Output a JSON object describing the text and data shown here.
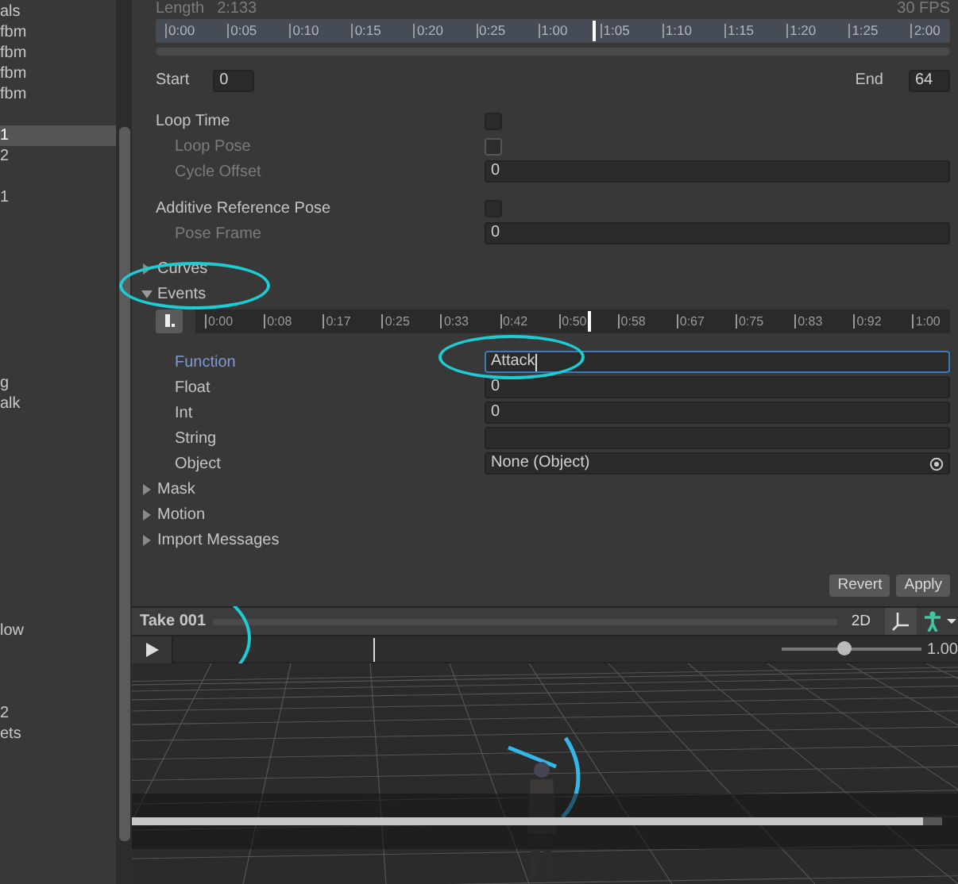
{
  "sidebar": {
    "items": [
      {
        "text": "als",
        "selected": false
      },
      {
        "text": "fbm",
        "selected": false
      },
      {
        "text": "fbm",
        "selected": false
      },
      {
        "text": "fbm",
        "selected": false
      },
      {
        "text": "fbm",
        "selected": false
      },
      {
        "text": "1",
        "selected": true
      },
      {
        "text": "2",
        "selected": false
      },
      {
        "text": "1",
        "selected": false
      },
      {
        "text": "g",
        "selected": false
      },
      {
        "text": "alk",
        "selected": false
      },
      {
        "text": "low",
        "selected": false
      },
      {
        "text": "2",
        "selected": false
      },
      {
        "text": "ets",
        "selected": false
      }
    ]
  },
  "clip": {
    "length_label": "Length",
    "length": "2:133",
    "fps": "30 FPS",
    "ruler": [
      "0:00",
      "0:05",
      "0:10",
      "0:15",
      "0:20",
      "0:25",
      "1:00",
      "1:05",
      "1:10",
      "1:15",
      "1:20",
      "1:25",
      "2:00"
    ],
    "start_label": "Start",
    "start": "0",
    "end_label": "End",
    "end": "64"
  },
  "properties": [
    {
      "kind": "checkbox",
      "label": "Loop Time",
      "indented": false,
      "disabled": false,
      "checked": false
    },
    {
      "kind": "checkbox",
      "label": "Loop Pose",
      "indented": true,
      "disabled": true,
      "checked": false
    },
    {
      "kind": "field",
      "label": "Cycle Offset",
      "indented": true,
      "disabled": true,
      "value": "0"
    },
    {
      "kind": "checkbox",
      "label": "Additive Reference Pose",
      "indented": false,
      "disabled": false,
      "checked": false
    },
    {
      "kind": "field",
      "label": "Pose Frame",
      "indented": true,
      "disabled": true,
      "value": "0"
    }
  ],
  "foldouts_top": [
    {
      "label": "Curves",
      "expanded": false,
      "circled": false
    },
    {
      "label": "Events",
      "expanded": true,
      "circled": true
    }
  ],
  "events": {
    "ruler": [
      "0:00",
      "0:08",
      "0:17",
      "0:25",
      "0:33",
      "0:42",
      "0:50",
      "0:58",
      "0:67",
      "0:75",
      "0:83",
      "0:92",
      "1:00"
    ],
    "params": [
      {
        "label": "Function",
        "value": "Attack",
        "focused": true,
        "circled": true,
        "kind": "text"
      },
      {
        "label": "Float",
        "value": "0",
        "focused": false,
        "circled": false,
        "kind": "text"
      },
      {
        "label": "Int",
        "value": "0",
        "focused": false,
        "circled": false,
        "kind": "text"
      },
      {
        "label": "String",
        "focused": false,
        "circled": false,
        "kind": "text"
      },
      {
        "label": "Object",
        "value": "None (Object)",
        "focused": false,
        "circled": false,
        "kind": "object"
      }
    ]
  },
  "foldouts_bottom": [
    {
      "label": "Mask",
      "expanded": false
    },
    {
      "label": "Motion",
      "expanded": false
    },
    {
      "label": "Import Messages",
      "expanded": false
    }
  ],
  "buttons": [
    "Revert",
    "Apply"
  ],
  "preview": {
    "title": "Take 001",
    "circled": true,
    "mode_2d": "2D",
    "speed": "1.00",
    "speed_slider": {
      "level": 0.45
    },
    "scrubber": {
      "level": 0.33
    }
  },
  "video": {
    "level": 0.98
  }
}
